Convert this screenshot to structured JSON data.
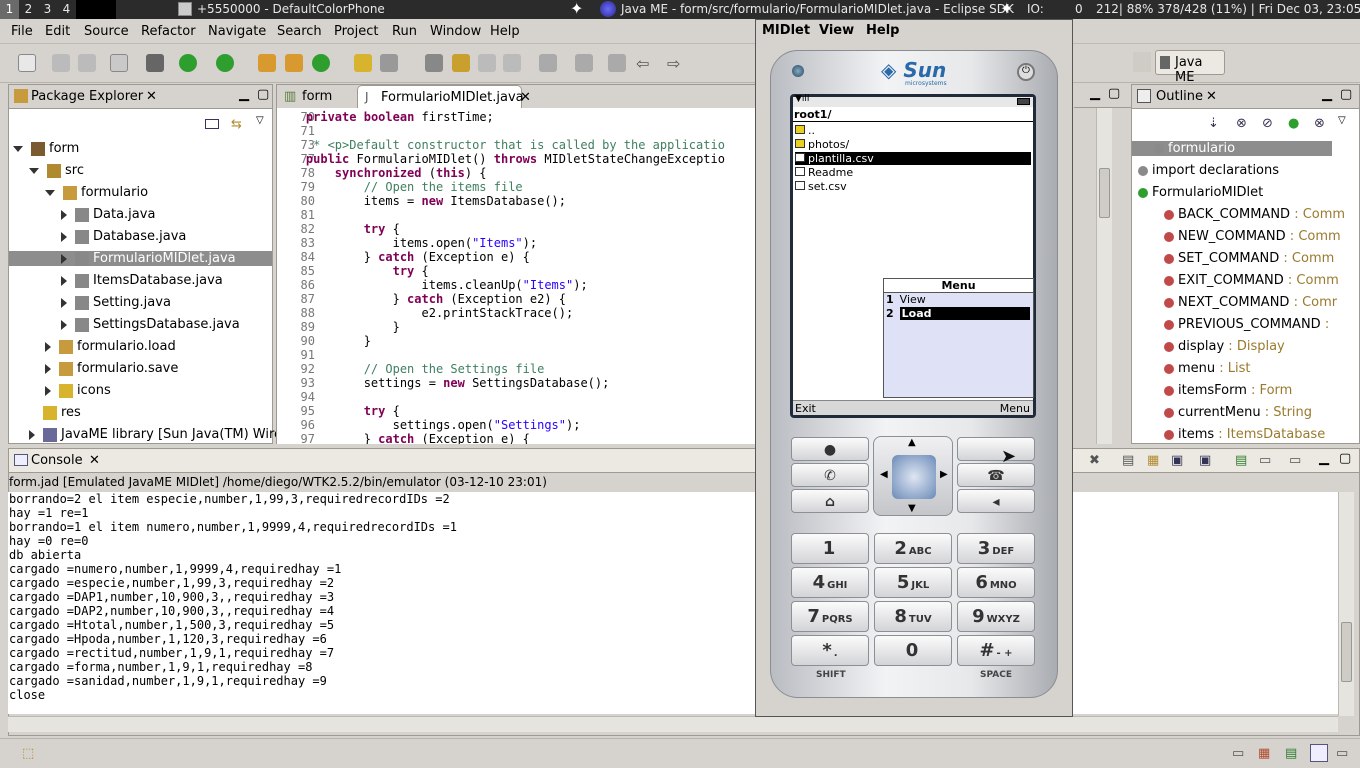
{
  "sysbar": {
    "workspaces": [
      "1",
      "2",
      "3",
      "4"
    ],
    "phone_title": "+5550000 - DefaultColorPhone",
    "eclipse_title": "Java ME - form/src/formulario/FormularioMIDlet.java - Eclipse SDK",
    "io": "IO:",
    "io_val": "0",
    "stats": "212| 88% 378/428 (11%) | Fri Dec 03, 23:05"
  },
  "menubar": [
    "File",
    "Edit",
    "Source",
    "Refactor",
    "Navigate",
    "Search",
    "Project",
    "Run",
    "Window",
    "Help"
  ],
  "perspective": "Java ME",
  "package_explorer": {
    "title": "Package Explorer",
    "tree": [
      {
        "label": "form",
        "depth": 0,
        "expanded": true,
        "icon": "project-icon"
      },
      {
        "label": "src",
        "depth": 1,
        "expanded": true,
        "icon": "source-folder-icon"
      },
      {
        "label": "formulario",
        "depth": 2,
        "expanded": true,
        "icon": "package-icon"
      },
      {
        "label": "Data.java",
        "depth": 3,
        "icon": "java-file-icon"
      },
      {
        "label": "Database.java",
        "depth": 3,
        "icon": "java-file-icon"
      },
      {
        "label": "FormularioMIDlet.java",
        "depth": 3,
        "icon": "java-file-icon",
        "selected": true
      },
      {
        "label": "ItemsDatabase.java",
        "depth": 3,
        "icon": "java-file-icon"
      },
      {
        "label": "Setting.java",
        "depth": 3,
        "icon": "java-file-icon"
      },
      {
        "label": "SettingsDatabase.java",
        "depth": 3,
        "icon": "java-file-icon"
      },
      {
        "label": "formulario.load",
        "depth": 2,
        "icon": "package-icon"
      },
      {
        "label": "formulario.save",
        "depth": 2,
        "icon": "package-icon"
      },
      {
        "label": "icons",
        "depth": 2,
        "icon": "folder-icon"
      },
      {
        "label": "res",
        "depth": 1,
        "icon": "folder-icon"
      },
      {
        "label": "JavaME library [Sun Java(TM) Wirele",
        "depth": 1,
        "icon": "library-icon"
      }
    ]
  },
  "editor": {
    "tabs": [
      "form",
      "FormularioMIDlet.java"
    ],
    "lines": [
      {
        "n": "70",
        "t": "    private boolean firstTime;"
      },
      {
        "n": "71",
        "t": ""
      },
      {
        "n": "73",
        "t": "     * <p>Default constructor that is called by the applicatio"
      },
      {
        "n": "77",
        "t": "    public FormularioMIDlet() throws MIDletStateChangeExceptio"
      },
      {
        "n": "78",
        "t": "        synchronized (this) {"
      },
      {
        "n": "79",
        "t": "            // Open the items file"
      },
      {
        "n": "80",
        "t": "            items = new ItemsDatabase();"
      },
      {
        "n": "81",
        "t": ""
      },
      {
        "n": "82",
        "t": "            try {"
      },
      {
        "n": "83",
        "t": "                items.open(\"Items\");"
      },
      {
        "n": "84",
        "t": "            } catch (Exception e) {"
      },
      {
        "n": "85",
        "t": "                try {"
      },
      {
        "n": "86",
        "t": "                    items.cleanUp(\"Items\");"
      },
      {
        "n": "87",
        "t": "                } catch (Exception e2) {"
      },
      {
        "n": "88",
        "t": "                    e2.printStackTrace();"
      },
      {
        "n": "89",
        "t": "                }"
      },
      {
        "n": "90",
        "t": "            }"
      },
      {
        "n": "91",
        "t": ""
      },
      {
        "n": "92",
        "t": "            // Open the Settings file"
      },
      {
        "n": "93",
        "t": "            settings = new SettingsDatabase();"
      },
      {
        "n": "94",
        "t": ""
      },
      {
        "n": "95",
        "t": "            try {"
      },
      {
        "n": "96",
        "t": "                settings.open(\"Settings\");"
      },
      {
        "n": "97",
        "t": "            } catch (Exception e) {"
      }
    ]
  },
  "outline": {
    "title": "Outline",
    "items": [
      {
        "label": "formulario",
        "type": "",
        "depth": 0,
        "selected": true
      },
      {
        "label": "import declarations",
        "type": "",
        "depth": 0
      },
      {
        "label": "FormularioMIDlet",
        "type": "",
        "depth": 0
      },
      {
        "label": "BACK_COMMAND",
        "type": " : Comm",
        "depth": 1
      },
      {
        "label": "NEW_COMMAND",
        "type": " : Comm",
        "depth": 1
      },
      {
        "label": "SET_COMMAND",
        "type": " : Comm",
        "depth": 1
      },
      {
        "label": "EXIT_COMMAND",
        "type": " : Comm",
        "depth": 1
      },
      {
        "label": "NEXT_COMMAND",
        "type": " : Comr",
        "depth": 1
      },
      {
        "label": "PREVIOUS_COMMAND",
        "type": " :",
        "depth": 1
      },
      {
        "label": "display",
        "type": " : Display",
        "depth": 1
      },
      {
        "label": "menu",
        "type": " : List",
        "depth": 1
      },
      {
        "label": "itemsForm",
        "type": " : Form",
        "depth": 1
      },
      {
        "label": "currentMenu",
        "type": " : String",
        "depth": 1
      },
      {
        "label": "items",
        "type": " : ItemsDatabase",
        "depth": 1
      }
    ]
  },
  "console": {
    "title": "Console",
    "header": "form.jad [Emulated JavaME MIDlet] /home/diego/WTK2.5.2/bin/emulator (03-12-10 23:01)",
    "lines": [
      "borrando=2 el item especie,number,1,99,3,requiredrecordIDs =2",
      "hay =1 re=1",
      "borrando=1 el item numero,number,1,9999,4,requiredrecordIDs =1",
      "hay =0 re=0",
      "db abierta",
      "cargado =numero,number,1,9999,4,requiredhay =1",
      "cargado =especie,number,1,99,3,requiredhay =2",
      "cargado =DAP1,number,10,900,3,,requiredhay =3",
      "cargado =DAP2,number,10,900,3,,requiredhay =4",
      "cargado =Htotal,number,1,500,3,requiredhay =5",
      "cargado =Hpoda,number,1,120,3,requiredhay =6",
      "cargado =rectitud,number,1,9,1,requiredhay =7",
      "cargado =forma,number,1,9,1,requiredhay =8",
      "cargado =sanidad,number,1,9,1,requiredhay =9",
      "close"
    ]
  },
  "emulator": {
    "menu": [
      "MIDlet",
      "View",
      "Help"
    ],
    "brand": "Sun",
    "brand_sub": "microsystems",
    "path": "root1/",
    "files": [
      {
        "name": "..",
        "icon": "folder-icon"
      },
      {
        "name": "photos/",
        "icon": "folder-icon"
      },
      {
        "name": "plantilla.csv",
        "icon": "file-icon",
        "selected": true
      },
      {
        "name": "Readme",
        "icon": "file-icon"
      },
      {
        "name": "set.csv",
        "icon": "file-icon"
      }
    ],
    "popup_title": "Menu",
    "popup_items": [
      {
        "num": "1",
        "label": "View"
      },
      {
        "num": "2",
        "label": "Load",
        "selected": true
      }
    ],
    "soft_left": "Exit",
    "soft_right": "Menu",
    "keys": [
      {
        "d": "1",
        "l": ""
      },
      {
        "d": "2",
        "l": "ABC"
      },
      {
        "d": "3",
        "l": "DEF"
      },
      {
        "d": "4",
        "l": "GHI"
      },
      {
        "d": "5",
        "l": "JKL"
      },
      {
        "d": "6",
        "l": "MNO"
      },
      {
        "d": "7",
        "l": "PQRS"
      },
      {
        "d": "8",
        "l": "TUV"
      },
      {
        "d": "9",
        "l": "WXYZ"
      },
      {
        "d": "*",
        "l": "."
      },
      {
        "d": "0",
        "l": ""
      },
      {
        "d": "#",
        "l": "- +"
      }
    ],
    "shift": "SHIFT",
    "space": "SPACE"
  }
}
